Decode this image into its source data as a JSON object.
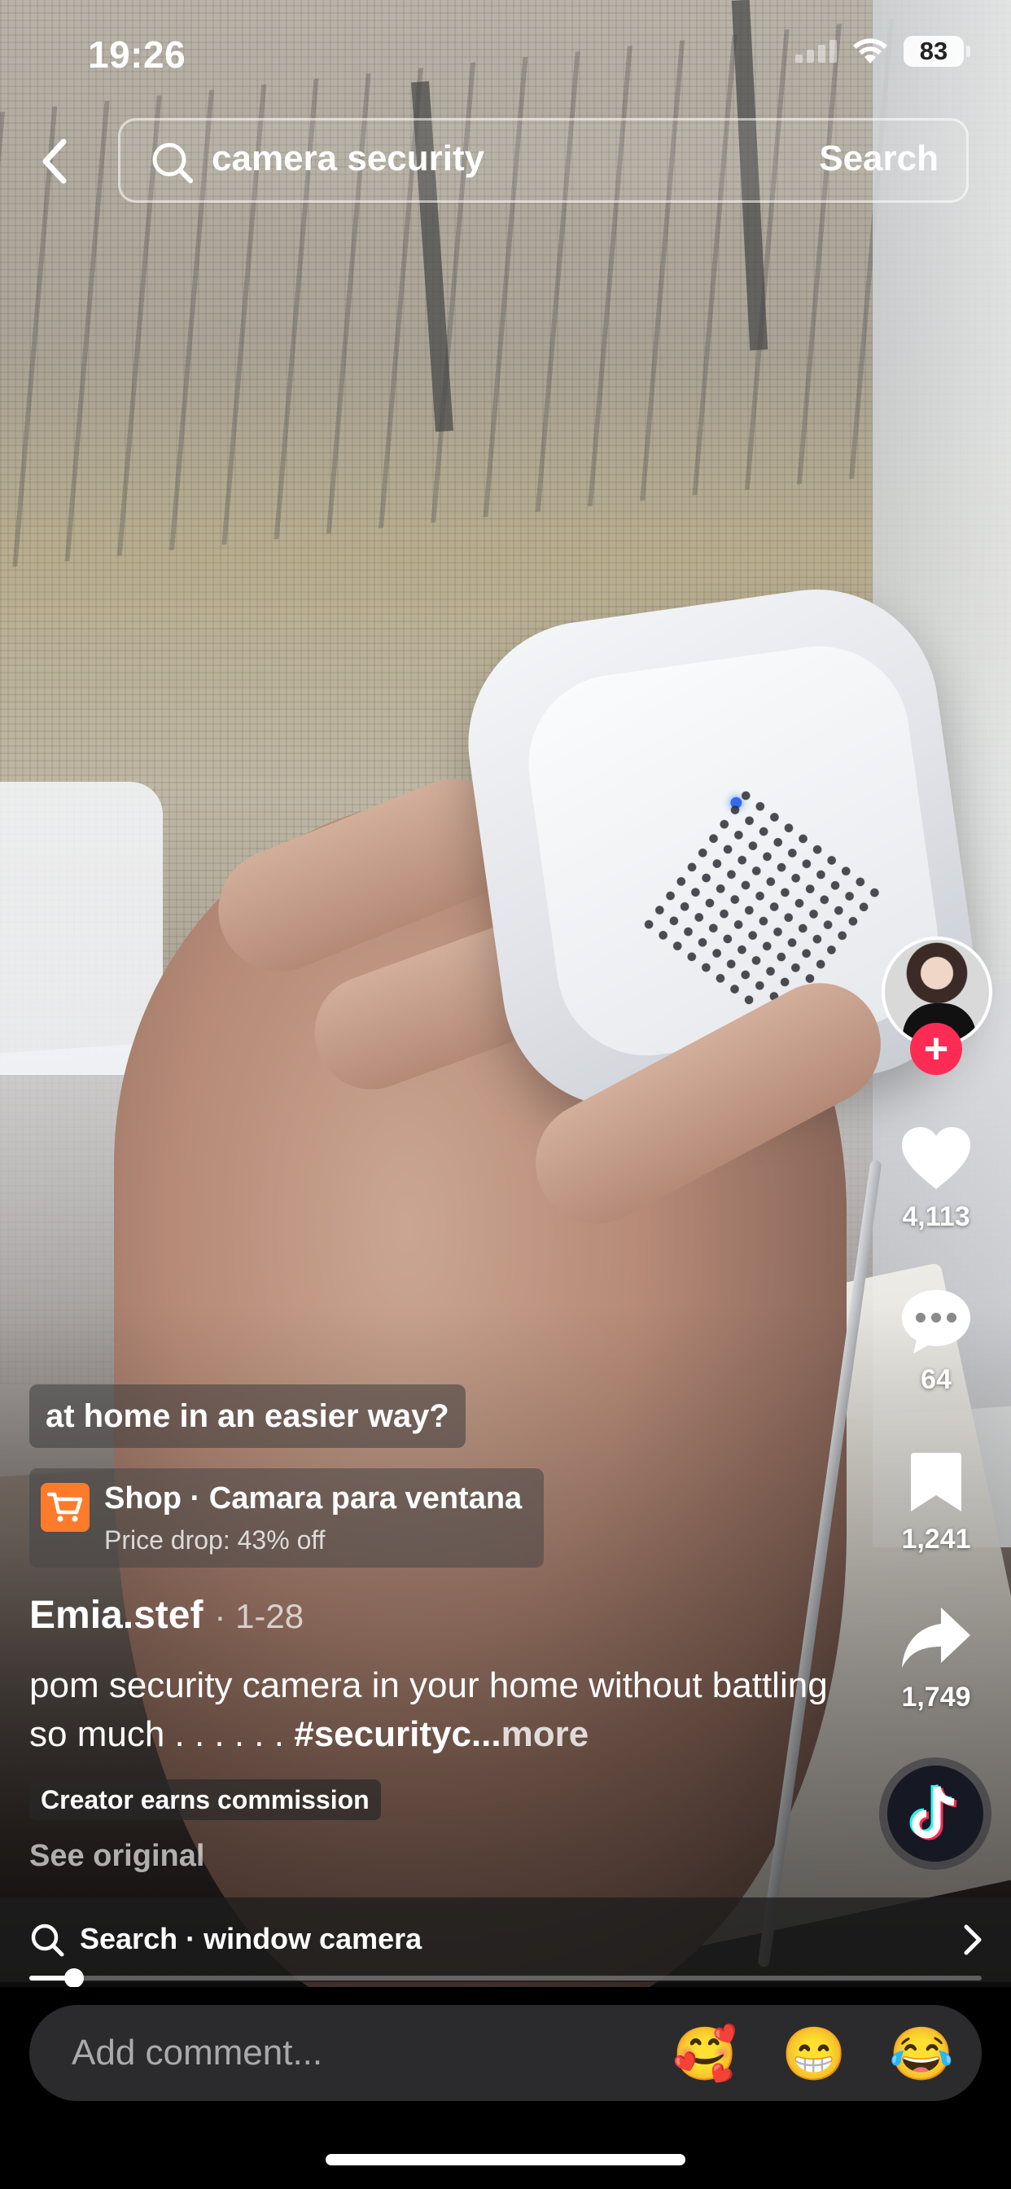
{
  "status_bar": {
    "time": "19:26",
    "battery": "83"
  },
  "search": {
    "query": "camera security",
    "button_label": "Search"
  },
  "actions": {
    "likes": "4,113",
    "comments": "64",
    "saves": "1,241",
    "shares": "1,749",
    "follow_symbol": "+"
  },
  "caption_chip": "at home in an easier way?",
  "shop": {
    "title": "Shop · Camara para ventana",
    "subtitle": "Price drop: 43% off"
  },
  "author": {
    "name": "Emia.stef",
    "date": "· 1-28"
  },
  "description": {
    "text": "pom security camera in your home without battling so much . . . . . .",
    "hashtag": "#securityc...",
    "more": "more"
  },
  "commission_badge": "Creator earns commission",
  "see_original": "See original",
  "related_search": {
    "text": "Search · window camera"
  },
  "playback": {
    "progress": 0.047
  },
  "comment": {
    "placeholder": "Add comment..."
  },
  "emojis": [
    "🥰",
    "😁",
    "😂"
  ],
  "colors": {
    "accent_red": "#fe2c55",
    "shop_orange": "#fe7b2c",
    "input_bg": "#2b2b2d"
  }
}
